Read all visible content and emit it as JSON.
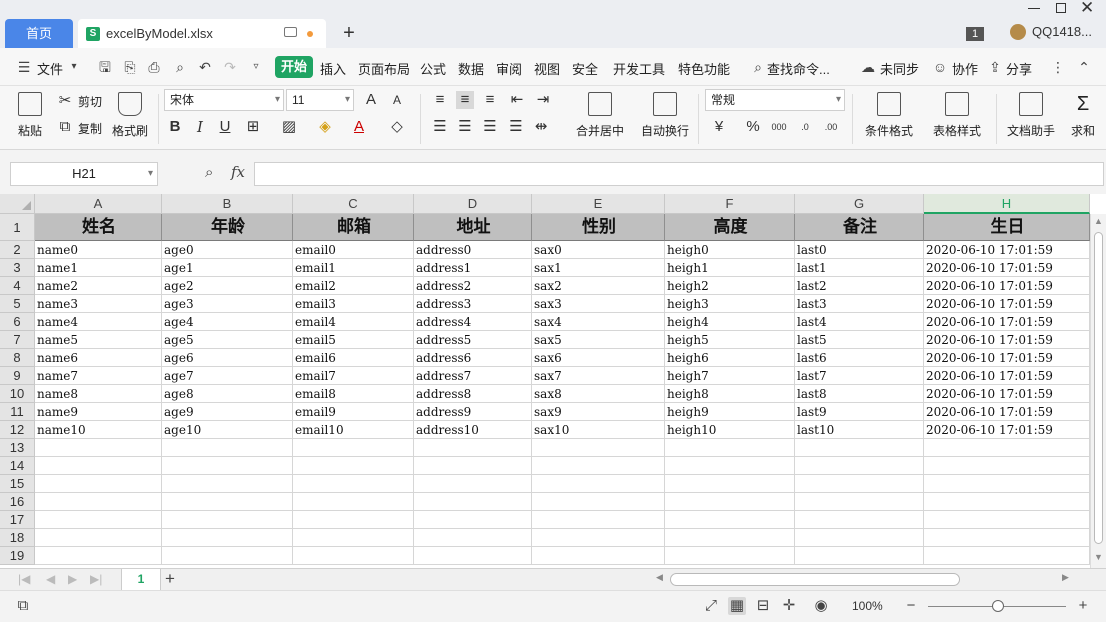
{
  "titlebar": {
    "home_tab": "首页",
    "file_tab": "excelByModel.xlsx",
    "add_tab": "+",
    "badge": "1",
    "user": "QQ1418..."
  },
  "menubar": {
    "file": "文件",
    "start": "开始",
    "items": [
      "插入",
      "页面布局",
      "公式",
      "数据",
      "审阅",
      "视图",
      "安全",
      "开发工具",
      "特色功能"
    ],
    "search": "查找命令...",
    "sync": "未同步",
    "collab": "协作",
    "share": "分享"
  },
  "ribbon": {
    "paste": "粘贴",
    "cut": "剪切",
    "copy": "复制",
    "format_painter": "格式刷",
    "font_name": "宋体",
    "font_size": "11",
    "merge_center": "合并居中",
    "wrap_text": "自动换行",
    "number_format": "常规",
    "cond_format": "条件格式",
    "table_style": "表格样式",
    "doc_helper": "文档助手",
    "sum": "求和"
  },
  "formula_bar": {
    "name_box": "H21",
    "fx": "fx",
    "value": ""
  },
  "sheet": {
    "columns": [
      "A",
      "B",
      "C",
      "D",
      "E",
      "F",
      "G",
      "H"
    ],
    "selected_column": "H",
    "row_numbers": [
      "1",
      "2",
      "3",
      "4",
      "5",
      "6",
      "7",
      "8",
      "9",
      "10",
      "11",
      "12",
      "13",
      "14",
      "15",
      "16",
      "17",
      "18",
      "19"
    ],
    "header_row": [
      "姓名",
      "年龄",
      "邮箱",
      "地址",
      "性别",
      "高度",
      "备注",
      "生日"
    ],
    "rows": [
      [
        "name0",
        "age0",
        "email0",
        "address0",
        "sax0",
        "heigh0",
        "last0",
        "2020-06-10 17:01:59"
      ],
      [
        "name1",
        "age1",
        "email1",
        "address1",
        "sax1",
        "heigh1",
        "last1",
        "2020-06-10 17:01:59"
      ],
      [
        "name2",
        "age2",
        "email2",
        "address2",
        "sax2",
        "heigh2",
        "last2",
        "2020-06-10 17:01:59"
      ],
      [
        "name3",
        "age3",
        "email3",
        "address3",
        "sax3",
        "heigh3",
        "last3",
        "2020-06-10 17:01:59"
      ],
      [
        "name4",
        "age4",
        "email4",
        "address4",
        "sax4",
        "heigh4",
        "last4",
        "2020-06-10 17:01:59"
      ],
      [
        "name5",
        "age5",
        "email5",
        "address5",
        "sax5",
        "heigh5",
        "last5",
        "2020-06-10 17:01:59"
      ],
      [
        "name6",
        "age6",
        "email6",
        "address6",
        "sax6",
        "heigh6",
        "last6",
        "2020-06-10 17:01:59"
      ],
      [
        "name7",
        "age7",
        "email7",
        "address7",
        "sax7",
        "heigh7",
        "last7",
        "2020-06-10 17:01:59"
      ],
      [
        "name8",
        "age8",
        "email8",
        "address8",
        "sax8",
        "heigh8",
        "last8",
        "2020-06-10 17:01:59"
      ],
      [
        "name9",
        "age9",
        "email9",
        "address9",
        "sax9",
        "heigh9",
        "last9",
        "2020-06-10 17:01:59"
      ],
      [
        "name10",
        "age10",
        "email10",
        "address10",
        "sax10",
        "heigh10",
        "last10",
        "2020-06-10 17:01:59"
      ]
    ]
  },
  "sheet_tabs": {
    "tabs": [
      "1"
    ],
    "add": "+"
  },
  "statusbar": {
    "zoom": "100%",
    "zoom_level": 1.0,
    "minus": "−",
    "plus": "+"
  },
  "colors": {
    "accent_green": "#1fa463",
    "home_tab_blue": "#4a86e8",
    "header_fill": "#bfbfbf"
  }
}
